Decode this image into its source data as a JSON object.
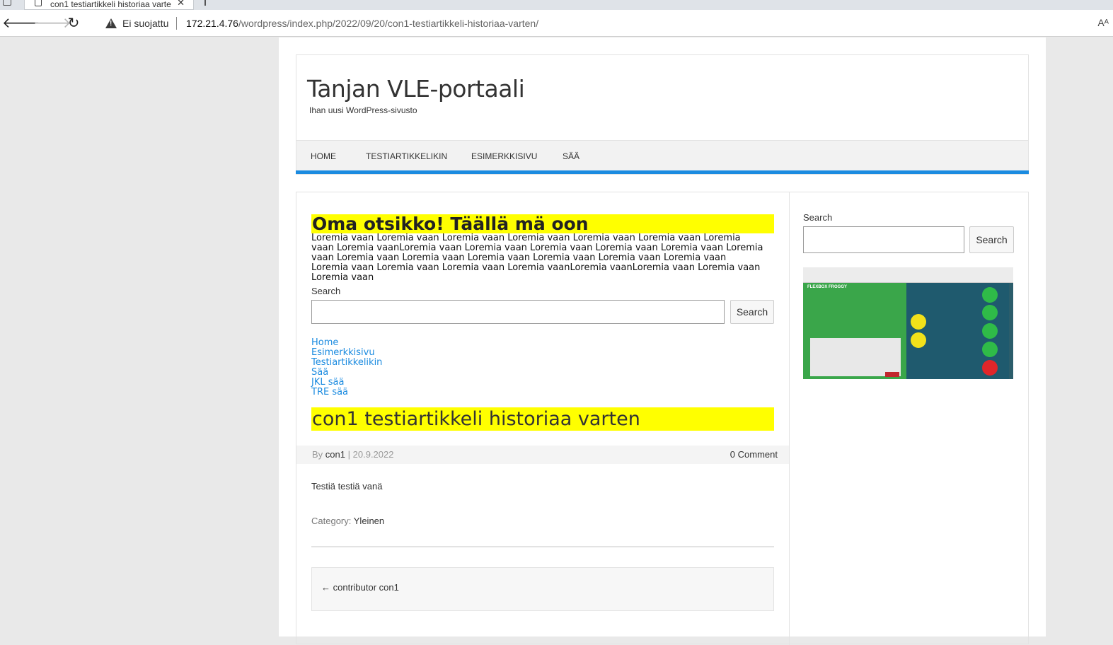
{
  "browser": {
    "tab_title": "con1 testiartikkeli historiaa varte",
    "tab_close": "✕",
    "security_label": "Ei suojattu",
    "url_host": "172.21.4.76",
    "url_path": "/wordpress/index.php/2022/09/20/con1-testiartikkeli-historiaa-varten/",
    "back_glyph": "🡐",
    "fwd_glyph": "🡒",
    "reload_glyph": "↻",
    "read_glyph": "Aᴬ"
  },
  "site": {
    "title": "Tanjan VLE-portaali",
    "description": "Ihan uusi WordPress-sivusto"
  },
  "nav": {
    "items": [
      "HOME",
      "TESTIARTIKKELIKIN",
      "ESIMERKKISIVU",
      "SÄÄ"
    ]
  },
  "main": {
    "custom_heading": "Oma otsikko! Täällä mä oon",
    "lorem": "Loremia vaan Loremia vaan Loremia vaan Loremia vaan Loremia vaan Loremia vaan Loremia vaan Loremia vaanLoremia vaan Loremia vaan Loremia vaan Loremia vaan Loremia vaan Loremia vaan Loremia vaan Loremia vaan Loremia vaan Loremia vaan Loremia vaan Loremia vaan Loremia vaan Loremia vaan Loremia vaan Loremia vaanLoremia vaanLoremia vaan Loremia vaan Loremia vaan",
    "search_label": "Search",
    "search_button": "Search",
    "search_value": "",
    "links": [
      "Home",
      "Esimerkkisivu",
      "Testiartikkelikin",
      "Sää",
      "JKL sää",
      "TRE sää"
    ],
    "post_title": "con1 testiartikkeli historiaa varten",
    "meta_by": "By",
    "meta_author": "con1",
    "meta_sep": "|",
    "meta_date": "20.9.2022",
    "meta_comments": "0 Comment",
    "post_body": "Testiä testiä vanä",
    "category_label": "Category:",
    "category_value": "Yleinen",
    "post_nav_prev": "← contributor con1"
  },
  "sidebar": {
    "search_label": "Search",
    "search_button": "Search",
    "search_value": "",
    "image_brand": "FLEXBOX FROGGY"
  },
  "colors": {
    "highlight": "#ffff00",
    "accent": "#1b8be0"
  }
}
